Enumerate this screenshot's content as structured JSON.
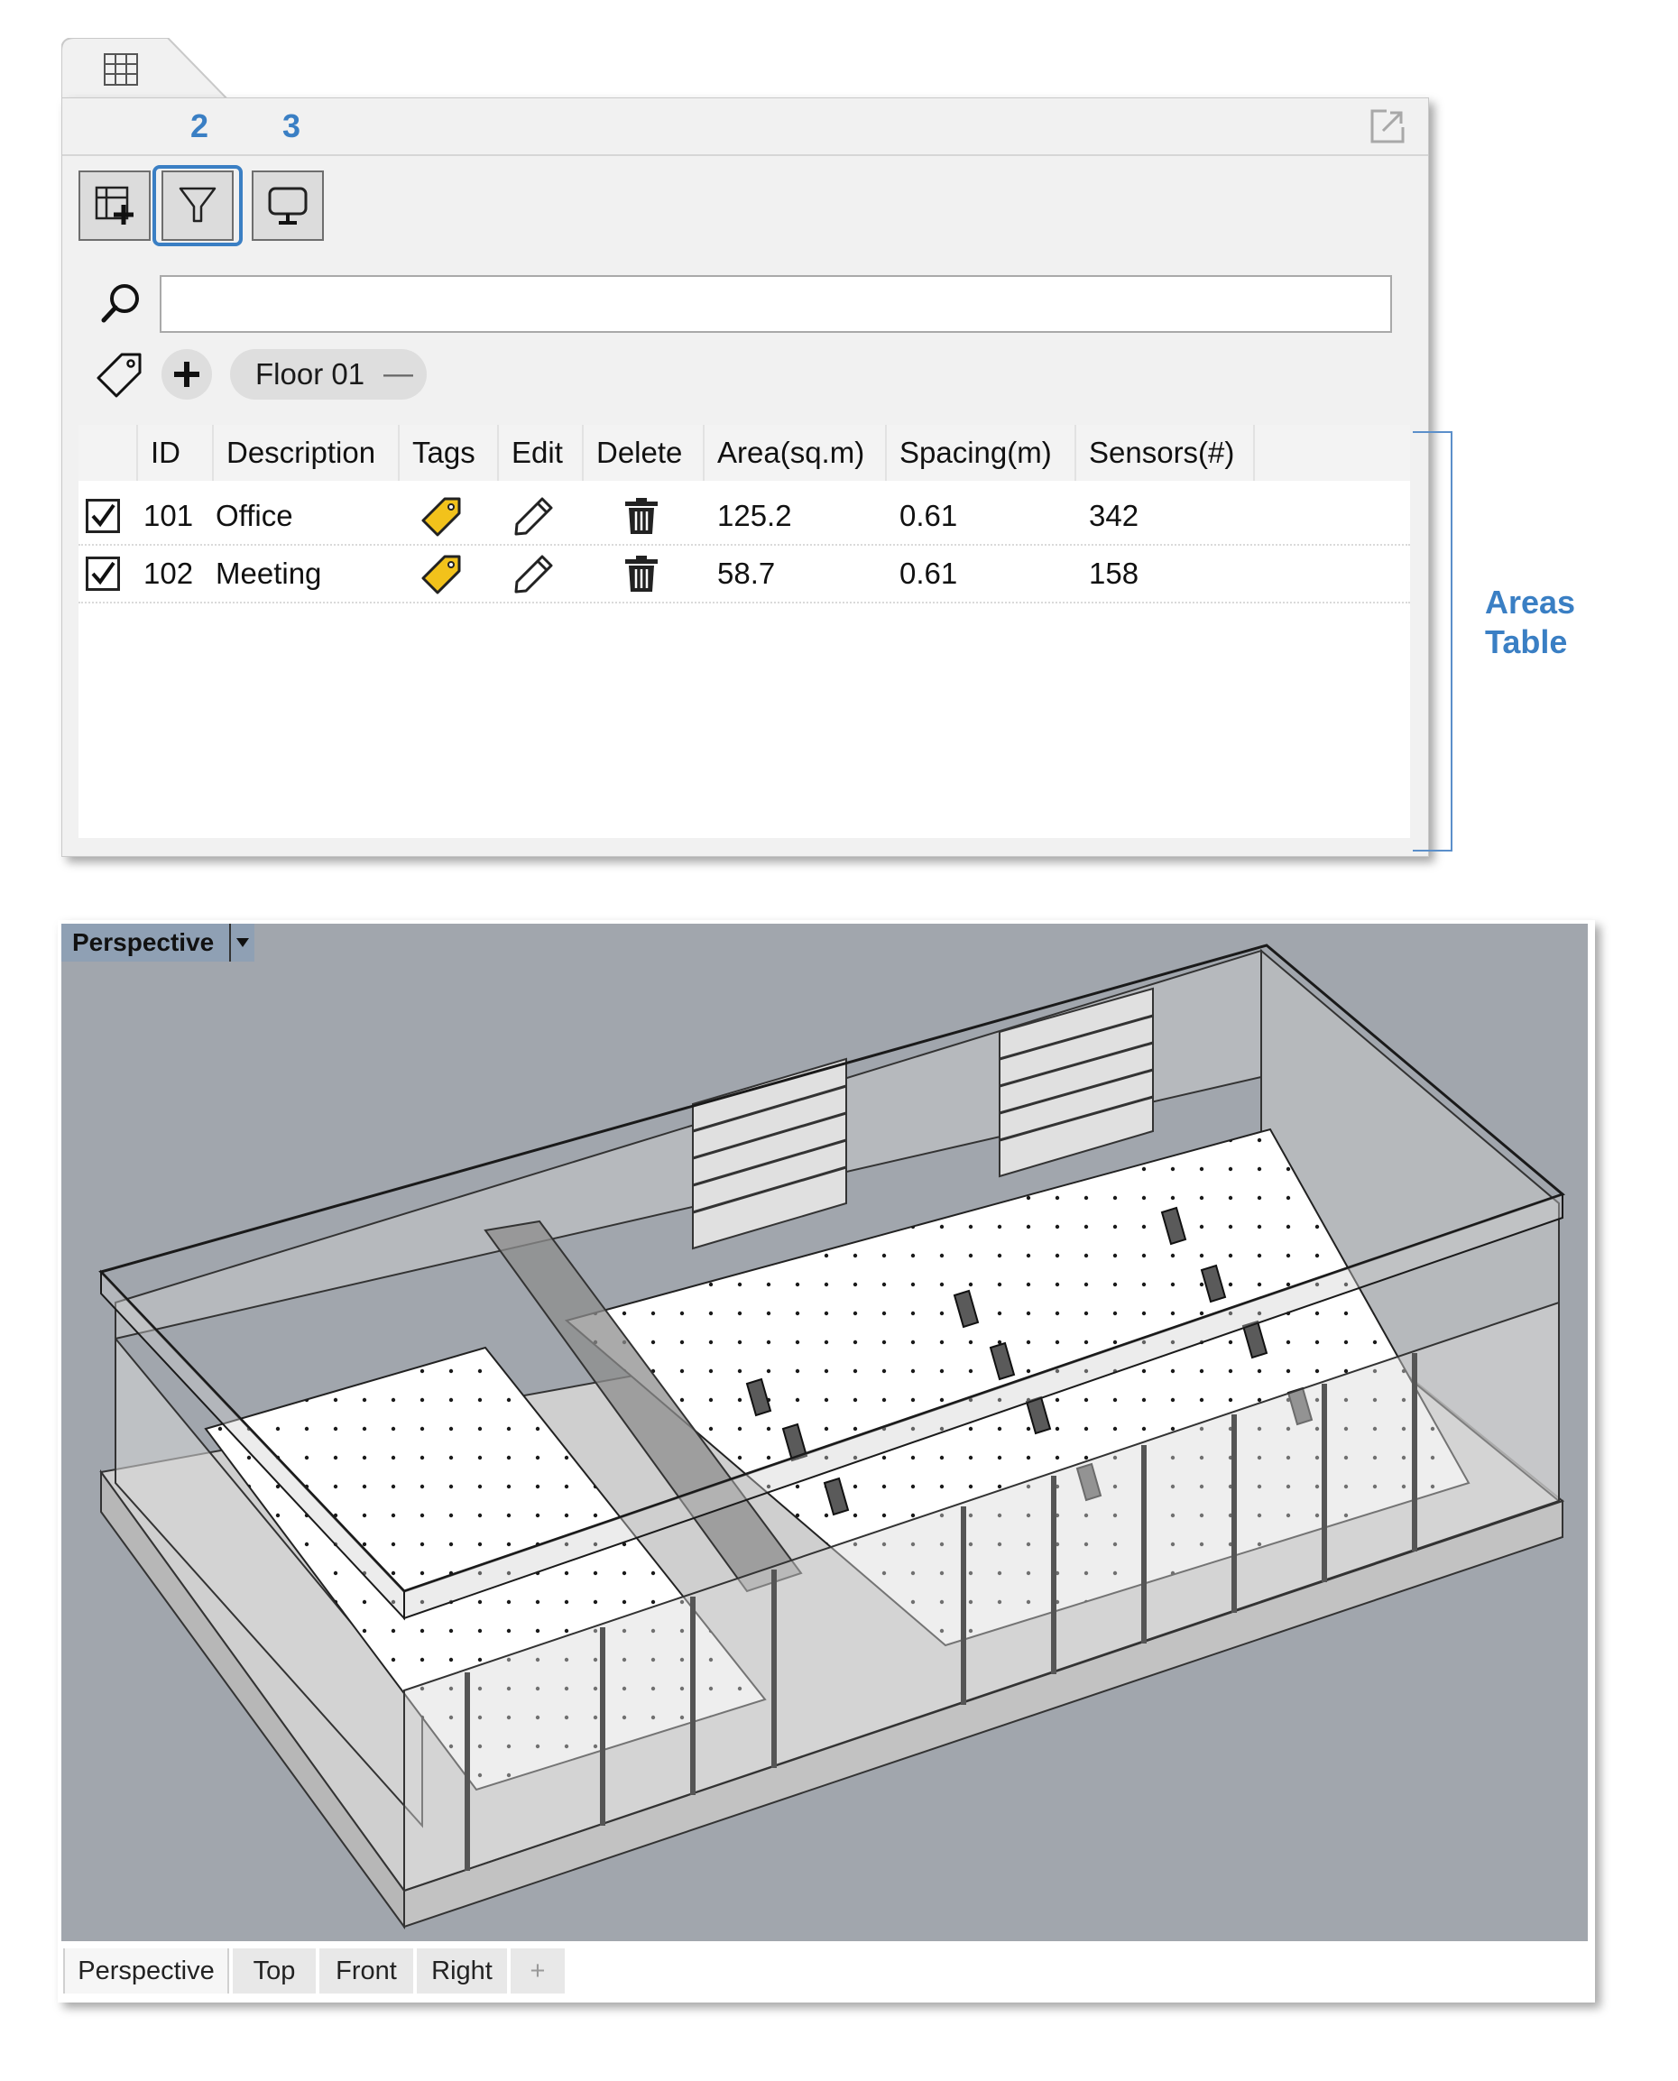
{
  "panel": {
    "callouts": {
      "filter": "2",
      "display": "3"
    },
    "search": {
      "value": "",
      "placeholder": ""
    },
    "tag_chip": {
      "label": "Floor 01",
      "remove": "—"
    },
    "table": {
      "columns": [
        "",
        "ID",
        "Description",
        "Tags",
        "Edit",
        "Delete",
        "Area(sq.m)",
        "Spacing(m)",
        "Sensors(#)"
      ],
      "rows": [
        {
          "checked": true,
          "id": "101",
          "description": "Office",
          "area": "125.2",
          "spacing": "0.61",
          "sensors": "342"
        },
        {
          "checked": true,
          "id": "102",
          "description": "Meeting",
          "area": "58.7",
          "spacing": "0.61",
          "sensors": "158"
        }
      ]
    },
    "annotation": {
      "line1": "Areas",
      "line2": "Table"
    }
  },
  "viewport": {
    "label": "Perspective",
    "tabs": [
      "Perspective",
      "Top",
      "Front",
      "Right"
    ],
    "active_tab": "Perspective",
    "add_tab": "+"
  },
  "colors": {
    "accent": "#3a7fc4",
    "tag": "#f2c21b",
    "viewport_bg": "#a1a6ad"
  }
}
